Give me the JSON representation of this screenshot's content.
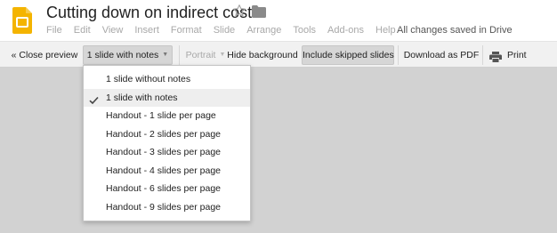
{
  "app": {
    "icon": "google-slides-logo",
    "brand_color": "#f4b400"
  },
  "document": {
    "title": "Cutting down on indirect costs",
    "star_icon": "star-outline-icon",
    "folder_icon": "folder-icon"
  },
  "menu": [
    "File",
    "Edit",
    "View",
    "Insert",
    "Format",
    "Slide",
    "Arrange",
    "Tools",
    "Add-ons",
    "Help"
  ],
  "save_status": "All changes saved in Drive",
  "toolbar": {
    "close_preview": "« Close preview",
    "layout": "1 slide with notes",
    "orientation": "Portrait",
    "hide_background": "Hide background",
    "include_skipped": "Include skipped slides",
    "download_pdf": "Download as PDF",
    "print": "Print"
  },
  "dropdown": {
    "selected_index": 1,
    "items": [
      "1 slide without notes",
      "1 slide with notes",
      "Handout - 1 slide per page",
      "Handout - 2 slides per page",
      "Handout - 3 slides per page",
      "Handout - 4 slides per page",
      "Handout - 6 slides per page",
      "Handout - 9 slides per page"
    ]
  },
  "colors": {
    "toolbar_bg": "#f1f1f1",
    "active_button_bg": "#d6d6d6",
    "preview_bg": "#d2d2d2",
    "disabled_text": "#a8a8a8"
  }
}
